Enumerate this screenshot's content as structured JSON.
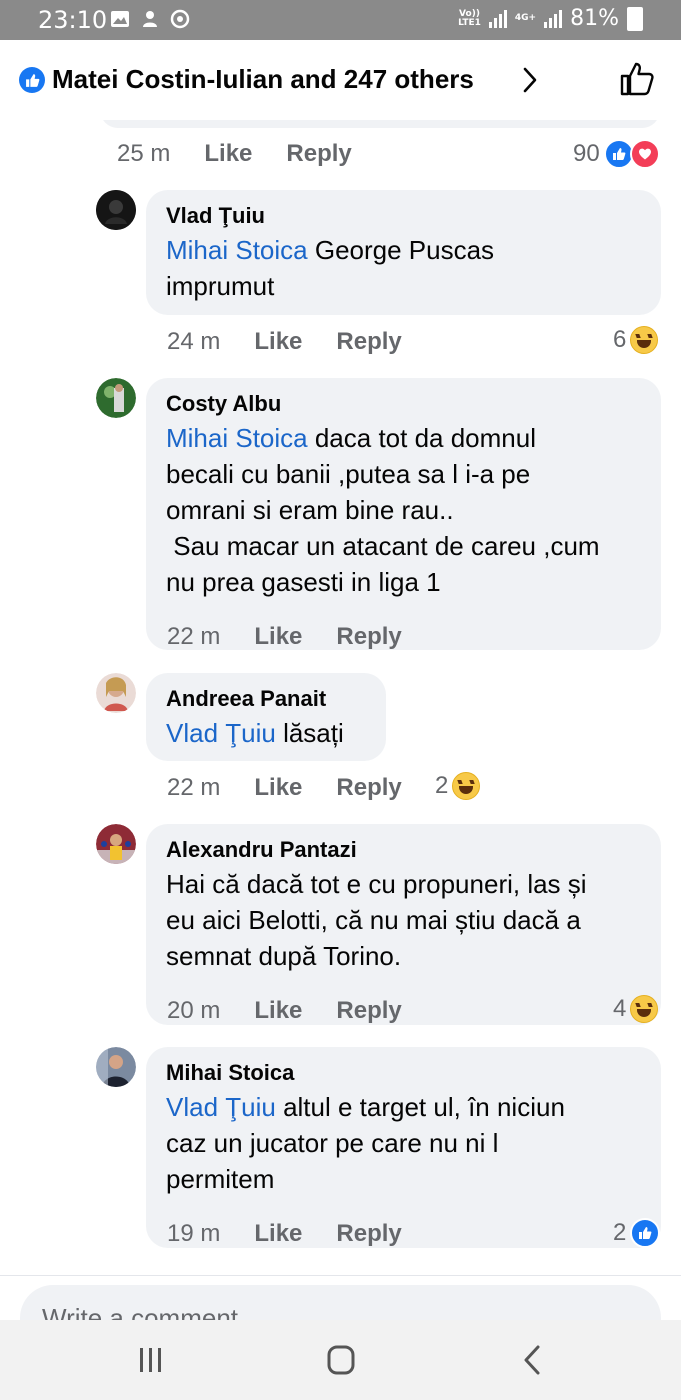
{
  "status_bar": {
    "time": "23:10",
    "network_top": "Vo))",
    "network_bottom": "LTE1",
    "data_type": "4G+",
    "battery": "81%"
  },
  "header": {
    "reactors_text": "Matei Costin-Iulian and 247 others"
  },
  "previous_comment": {
    "time": "25 m",
    "like_label": "Like",
    "reply_label": "Reply",
    "reaction_count": "90"
  },
  "comments": [
    {
      "author": "Vlad Ţuiu",
      "mention": "Mihai Stoica",
      "text": " George Puscas\nimprumut",
      "time": "24 m",
      "like_label": "Like",
      "reply_label": "Reply",
      "reaction_count": "6",
      "reaction": "haha-icon"
    },
    {
      "author": "Costy Albu",
      "mention": "Mihai Stoica",
      "text": " daca tot da domnul\nbecali cu banii ,putea sa l i-a pe\nomrani si eram bine rau..\n Sau macar un atacant de careu ,cum\nnu prea gasesti in liga 1",
      "time": "22 m",
      "like_label": "Like",
      "reply_label": "Reply",
      "reaction_count": "",
      "reaction": ""
    },
    {
      "author": "Andreea Panait",
      "mention": "Vlad Ţuiu",
      "text": " lăsați",
      "time": "22 m",
      "like_label": "Like",
      "reply_label": "Reply",
      "reaction_count": "2",
      "reaction": "haha-icon"
    },
    {
      "author": "Alexandru Pantazi",
      "mention": "",
      "text": "Hai că dacă tot e cu propuneri, las și\neu aici Belotti, că nu mai știu dacă a\nsemnat după Torino.",
      "time": "20 m",
      "like_label": "Like",
      "reply_label": "Reply",
      "reaction_count": "4",
      "reaction": "haha-icon"
    },
    {
      "author": "Mihai Stoica",
      "mention": "Vlad Ţuiu",
      "text": " altul e target ul, în niciun\ncaz un jucator pe care nu ni l\npermitem",
      "time": "19 m",
      "like_label": "Like",
      "reply_label": "Reply",
      "reaction_count": "2",
      "reaction": "like-icon"
    }
  ],
  "composer": {
    "placeholder": "Write a comment…"
  },
  "colors": {
    "accent_blue": "#1877f2",
    "mention_blue": "#1b66c9",
    "bubble_bg": "#f0f2f5",
    "status_bar_bg": "#8a8a8a"
  }
}
